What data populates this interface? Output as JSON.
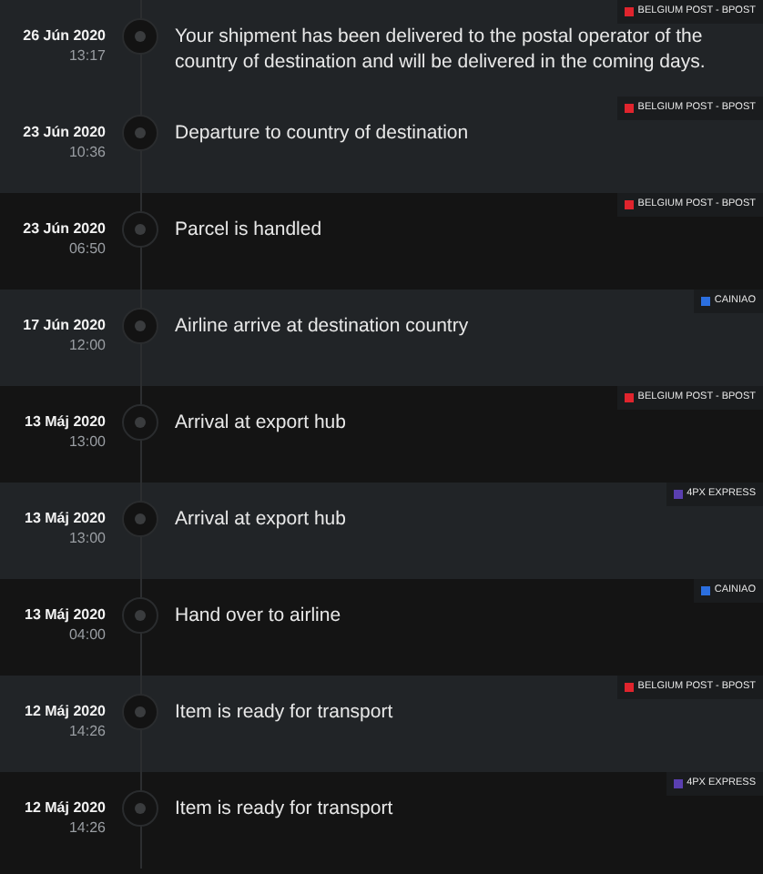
{
  "events": [
    {
      "date": "26 Jún 2020",
      "time": "13:17",
      "text": "Your shipment has been delivered to the postal operator of the country of destination and will be delivered in the coming days.",
      "carrier": "BELGIUM POST - BPOST",
      "color": "#e0242d",
      "highlighted": true
    },
    {
      "date": "23 Jún 2020",
      "time": "10:36",
      "text": "Departure to country of destination",
      "carrier": "BELGIUM POST - BPOST",
      "color": "#e0242d",
      "highlighted": true
    },
    {
      "date": "23 Jún 2020",
      "time": "06:50",
      "text": "Parcel is handled",
      "carrier": "BELGIUM POST - BPOST",
      "color": "#e0242d",
      "highlighted": false
    },
    {
      "date": "17 Jún 2020",
      "time": "12:00",
      "text": "Airline arrive at destination country",
      "carrier": "CAINIAO",
      "color": "#2b6fe0",
      "highlighted": true
    },
    {
      "date": "13 Máj 2020",
      "time": "13:00",
      "text": "Arrival at export hub",
      "carrier": "BELGIUM POST - BPOST",
      "color": "#e0242d",
      "highlighted": false
    },
    {
      "date": "13 Máj 2020",
      "time": "13:00",
      "text": "Arrival at export hub",
      "carrier": "4PX EXPRESS",
      "color": "#5a3fb0",
      "highlighted": true
    },
    {
      "date": "13 Máj 2020",
      "time": "04:00",
      "text": "Hand over to airline",
      "carrier": "CAINIAO",
      "color": "#2b6fe0",
      "highlighted": false
    },
    {
      "date": "12 Máj 2020",
      "time": "14:26",
      "text": "Item is ready for transport",
      "carrier": "BELGIUM POST - BPOST",
      "color": "#e0242d",
      "highlighted": true
    },
    {
      "date": "12 Máj 2020",
      "time": "14:26",
      "text": "Item is ready for transport",
      "carrier": "4PX EXPRESS",
      "color": "#5a3fb0",
      "highlighted": false
    }
  ]
}
